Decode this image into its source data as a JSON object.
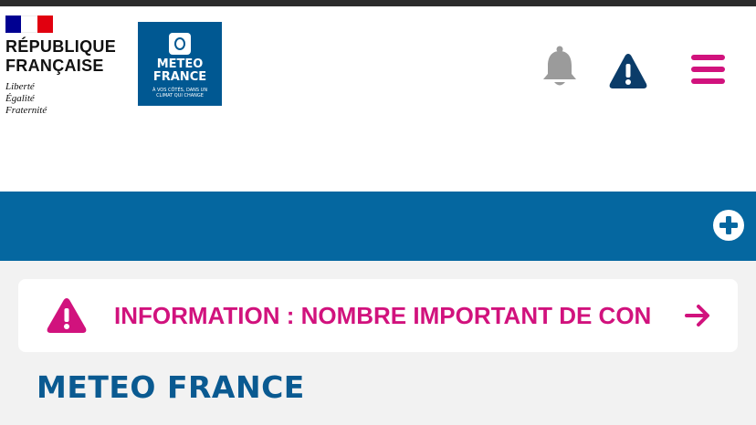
{
  "colors": {
    "brand_blue": "#005892",
    "bar_blue": "#0567a0",
    "magenta": "#d1127d",
    "dark_navy": "#0b3c69",
    "icon_gray": "#9b9b9b",
    "page_gray": "#f2f2f2"
  },
  "header": {
    "rf_logo": {
      "name_line1": "RÉPUBLIQUE",
      "name_line2": "FRANÇAISE",
      "motto": [
        "Liberté",
        "Égalité",
        "Fraternité"
      ]
    },
    "mf_logo": {
      "line1": "METEO",
      "line2": "FRANCE",
      "tagline1": "À VOS CÔTÉS, DANS UN",
      "tagline2": "CLIMAT QUI CHANGE"
    },
    "icons": {
      "notifications": "bell-icon",
      "alerts": "warning-icon",
      "menu": "hamburger-menu-icon"
    }
  },
  "bluebar": {
    "expand_icon": "plus-circle-icon"
  },
  "alert": {
    "text": "INFORMATION : NOMBRE IMPORTANT DE CON",
    "icon": "warning-icon",
    "arrow": "arrow-right-icon"
  },
  "section": {
    "title": "METEO FRANCE"
  }
}
